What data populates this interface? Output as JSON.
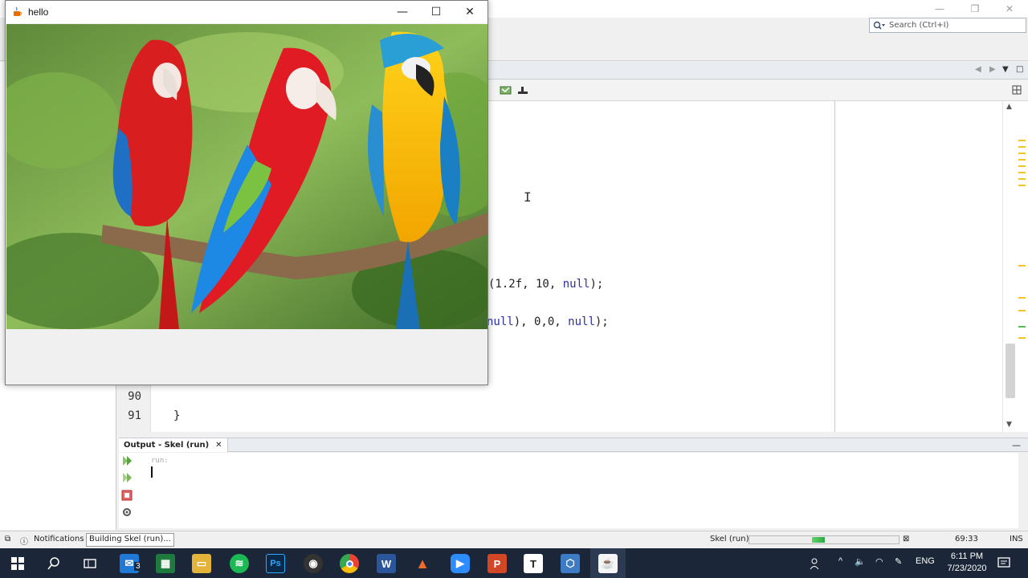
{
  "java_window": {
    "title": "hello",
    "controls": {
      "minimize": "—",
      "maximize": "☐",
      "close": "✕"
    }
  },
  "ide": {
    "window_controls": {
      "minimize": "—",
      "restore": "❐",
      "close": "✕"
    },
    "search": {
      "placeholder": "Search (Ctrl+I)"
    },
    "code_lines": [
      {
        "text": "(1.2f, 10, null);"
      },
      {
        "text": "null), 0,0, null);"
      }
    ],
    "line_numbers": [
      "90",
      "91"
    ],
    "line_91_text": "}"
  },
  "output": {
    "tab_label": "Output - Skel (run)",
    "close_glyph": "✕",
    "run_text": "run:"
  },
  "statusbar": {
    "notifications": "Notifications",
    "build_task": "Building Skel (run)...",
    "project": "Skel (run)",
    "progress": 0.45,
    "position": "69:33",
    "mode": "INS"
  },
  "taskbar": {
    "mail_badge": "3",
    "language": "ENG",
    "time": "6:11 PM",
    "date": "7/23/2020",
    "apps": [
      "windows-start",
      "search",
      "task-view",
      "mail",
      "excel-like",
      "file-explorer",
      "spotify",
      "photoshop",
      "media-player",
      "chrome",
      "word",
      "inkscape",
      "zoom",
      "powerpoint",
      "typora",
      "virtualbox",
      "java"
    ]
  }
}
